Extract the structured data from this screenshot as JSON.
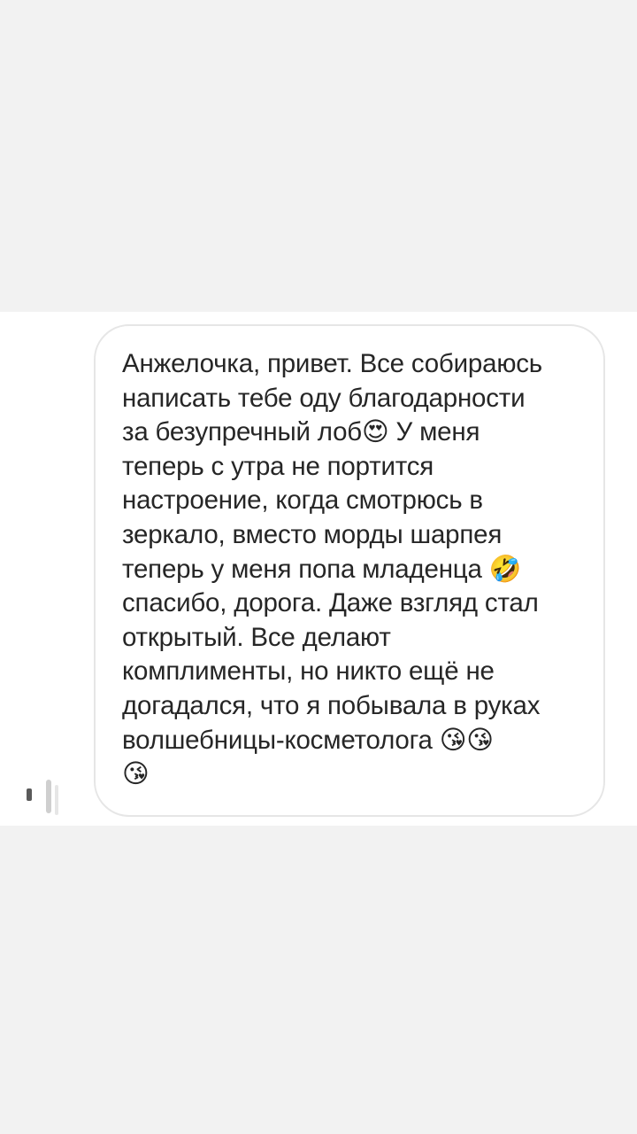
{
  "message": {
    "text": "Анжелочка, привет. Все собираюсь\nнаписать тебе оду благодарности\nза безупречный лоб😍 У меня\nтеперь с утра не портится\nнастроение, когда смотрюсь в\nзеркало, вместо морды шарпея\nтеперь у меня попа младенца 🤣\nспасибо, дорога. Даже взгляд стал\nоткрытый. Все делают\nкомплименты, но никто ещё не\nдогадался, что я побывала в руках\nволшебницы-косметолога 😘😘\n😘"
  },
  "colors": {
    "page_background": "#f2f2f2",
    "chat_background": "#ffffff",
    "bubble_border": "#e6e6e6",
    "text": "#262626"
  }
}
